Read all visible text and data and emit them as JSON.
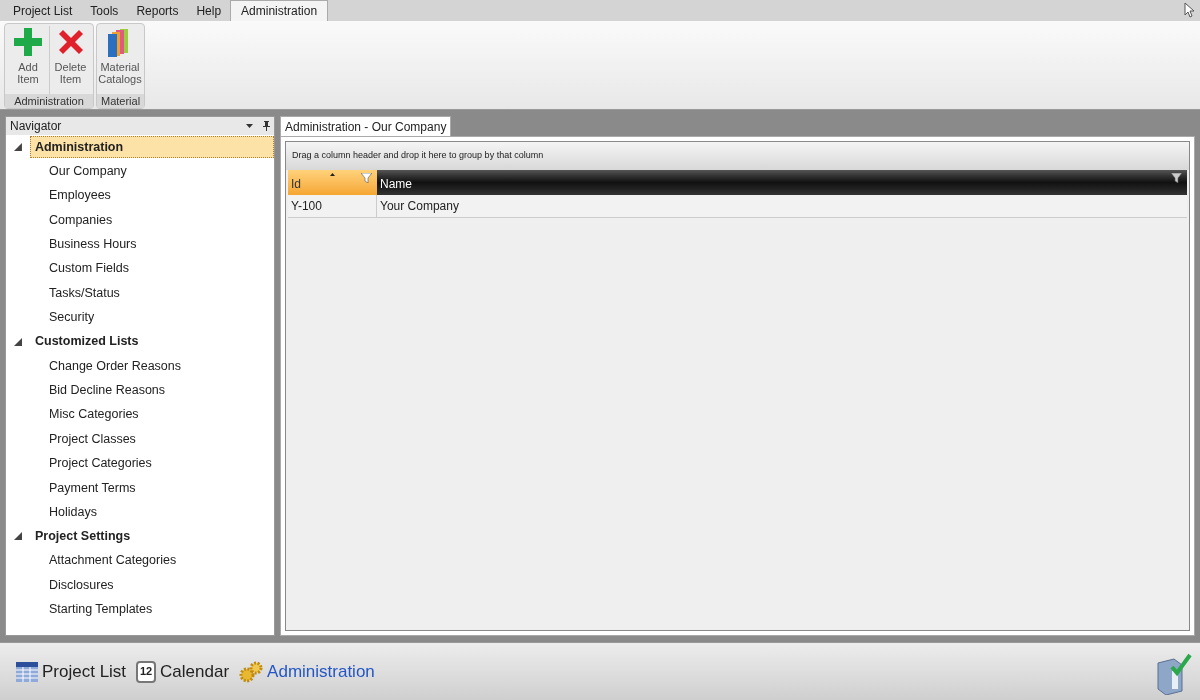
{
  "menu_tabs": [
    {
      "label": "Project List",
      "selected": false
    },
    {
      "label": "Tools",
      "selected": false
    },
    {
      "label": "Reports",
      "selected": false
    },
    {
      "label": "Help",
      "selected": false
    },
    {
      "label": "Administration",
      "selected": true
    }
  ],
  "ribbon": {
    "groups": [
      {
        "label": "Administration",
        "buttons": [
          {
            "kind": "add",
            "label": "Add Item"
          },
          {
            "kind": "delete",
            "label": "Delete Item"
          }
        ]
      },
      {
        "label": "Material",
        "buttons": [
          {
            "kind": "books",
            "label": "Material Catalogs"
          }
        ]
      }
    ]
  },
  "navigator": {
    "title": "Navigator",
    "tree": [
      {
        "label": "Administration",
        "expanded": true,
        "selected": true,
        "children": [
          {
            "label": "Our Company"
          },
          {
            "label": "Employees"
          },
          {
            "label": "Companies"
          },
          {
            "label": "Business Hours"
          },
          {
            "label": "Custom Fields"
          },
          {
            "label": "Tasks/Status"
          },
          {
            "label": "Security"
          }
        ]
      },
      {
        "label": "Customized Lists",
        "expanded": true,
        "selected": false,
        "children": [
          {
            "label": "Change Order Reasons"
          },
          {
            "label": "Bid Decline Reasons"
          },
          {
            "label": "Misc Categories"
          },
          {
            "label": "Project Classes"
          },
          {
            "label": "Project Categories"
          },
          {
            "label": "Payment Terms"
          },
          {
            "label": "Holidays"
          }
        ]
      },
      {
        "label": "Project Settings",
        "expanded": true,
        "selected": false,
        "children": [
          {
            "label": "Attachment Categories"
          },
          {
            "label": "Disclosures"
          },
          {
            "label": "Starting Templates"
          }
        ]
      }
    ]
  },
  "document_tab": {
    "label": "Administration - Our Company"
  },
  "grid": {
    "group_hint": "Drag a column header and drop it here to group by that column",
    "columns": [
      {
        "label": "Id",
        "sorted": true
      },
      {
        "label": "Name",
        "sorted": false
      }
    ],
    "rows": [
      [
        "Y-100",
        "Your Company"
      ]
    ]
  },
  "bottom_nav": [
    {
      "kind": "table",
      "label": "Project List",
      "selected": false
    },
    {
      "kind": "calendar",
      "label": "Calendar",
      "icon_text": "12",
      "selected": false
    },
    {
      "kind": "gears",
      "label": "Administration",
      "selected": true
    }
  ]
}
